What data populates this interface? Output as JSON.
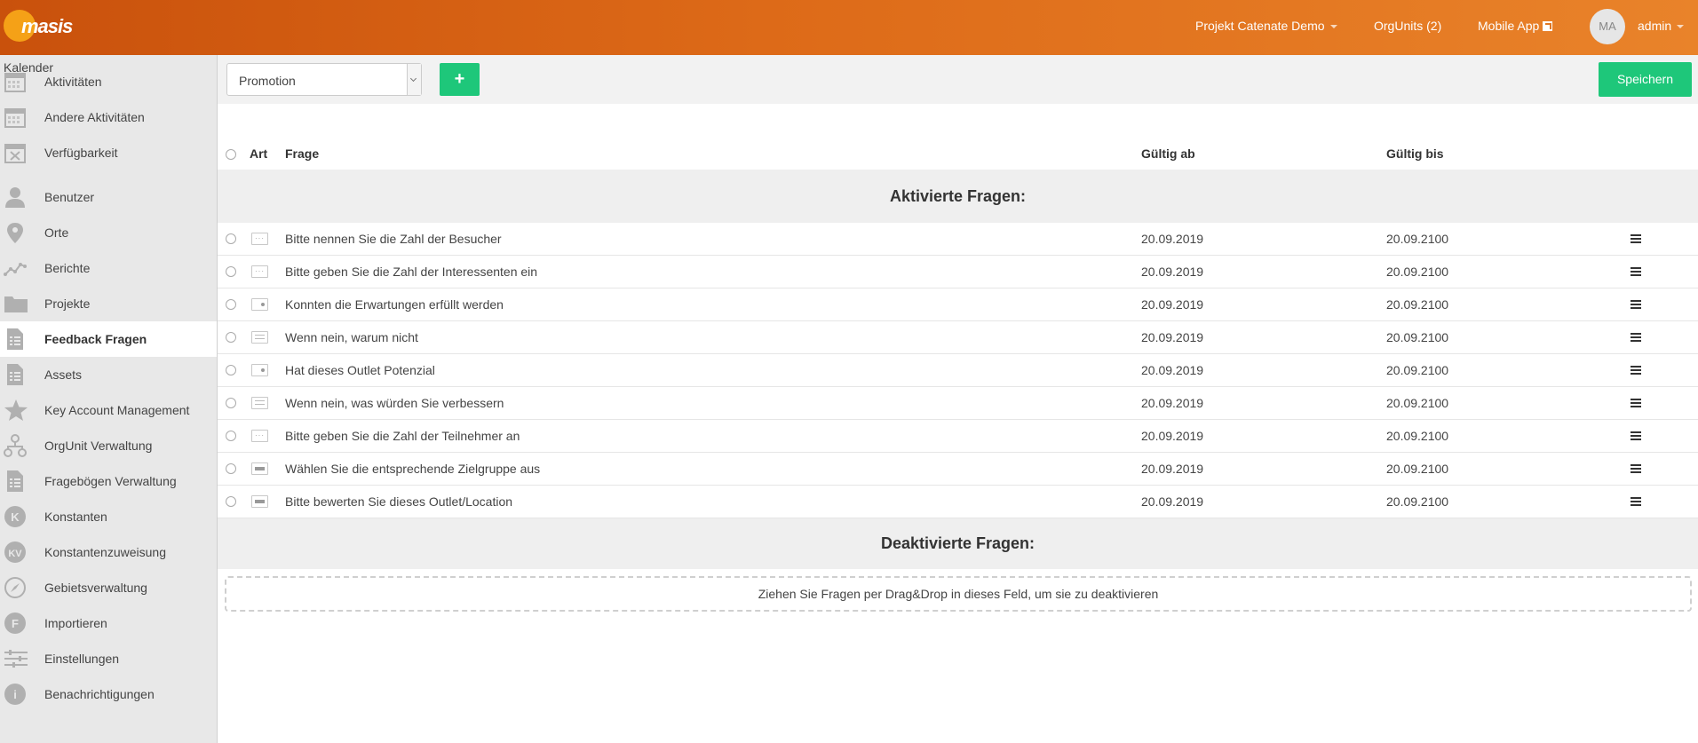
{
  "header": {
    "logo_text": "masis",
    "project": "Projekt Catenate Demo",
    "orgunits": "OrgUnits (2)",
    "mobile_app": "Mobile App",
    "avatar_initials": "MA",
    "user": "admin"
  },
  "sidebar": {
    "heading": "Kalender",
    "items": [
      {
        "label": "Aktivitäten",
        "icon": "calendar-icon"
      },
      {
        "label": "Andere Aktivitäten",
        "icon": "calendar-icon"
      },
      {
        "label": "Verfügbarkeit",
        "icon": "calendar-x-icon"
      },
      {
        "label": "Benutzer",
        "icon": "user-icon"
      },
      {
        "label": "Orte",
        "icon": "map-pin-icon"
      },
      {
        "label": "Berichte",
        "icon": "line-chart-icon"
      },
      {
        "label": "Projekte",
        "icon": "folder-icon"
      },
      {
        "label": "Feedback Fragen",
        "icon": "document-list-icon"
      },
      {
        "label": "Assets",
        "icon": "document-list-icon"
      },
      {
        "label": "Key Account Management",
        "icon": "star-icon"
      },
      {
        "label": "OrgUnit Verwaltung",
        "icon": "org-tree-icon"
      },
      {
        "label": "Fragebögen Verwaltung",
        "icon": "document-list-icon"
      },
      {
        "label": "Konstanten",
        "icon": "k-circle-icon",
        "glyph": "K"
      },
      {
        "label": "Konstantenzuweisung",
        "icon": "kv-circle-icon",
        "glyph": "KV"
      },
      {
        "label": "Gebietsverwaltung",
        "icon": "compass-icon"
      },
      {
        "label": "Importieren",
        "icon": "f-circle-icon",
        "glyph": "F"
      },
      {
        "label": "Einstellungen",
        "icon": "sliders-icon"
      },
      {
        "label": "Benachrichtigungen",
        "icon": "info-circle-icon",
        "glyph": "i"
      }
    ],
    "active_index": 7
  },
  "toolbar": {
    "select_value": "Promotion",
    "add_label": "+",
    "save_label": "Speichern"
  },
  "table": {
    "columns": {
      "art": "Art",
      "frage": "Frage",
      "gueltig_ab": "Gültig ab",
      "gueltig_bis": "Gültig bis"
    },
    "active_section": "Aktivierte Fragen:",
    "inactive_section": "Deaktivierte Fragen:",
    "rows": [
      {
        "type": "number",
        "question": "Bitte nennen Sie die Zahl der Besucher",
        "from": "20.09.2019",
        "to": "20.09.2100"
      },
      {
        "type": "number",
        "question": "Bitte geben Sie die Zahl der Interessenten ein",
        "from": "20.09.2019",
        "to": "20.09.2100"
      },
      {
        "type": "toggle",
        "question": "Konnten die Erwartungen erfüllt werden",
        "from": "20.09.2019",
        "to": "20.09.2100"
      },
      {
        "type": "text",
        "question": "Wenn nein, warum nicht",
        "from": "20.09.2019",
        "to": "20.09.2100"
      },
      {
        "type": "toggle",
        "question": "Hat dieses Outlet Potenzial",
        "from": "20.09.2019",
        "to": "20.09.2100"
      },
      {
        "type": "text",
        "question": "Wenn nein, was würden Sie verbessern",
        "from": "20.09.2019",
        "to": "20.09.2100"
      },
      {
        "type": "number",
        "question": "Bitte geben Sie die Zahl der Teilnehmer an",
        "from": "20.09.2019",
        "to": "20.09.2100"
      },
      {
        "type": "slider",
        "question": "Wählen Sie die entsprechende Zielgruppe aus",
        "from": "20.09.2019",
        "to": "20.09.2100"
      },
      {
        "type": "slider",
        "question": "Bitte bewerten Sie dieses Outlet/Location",
        "from": "20.09.2019",
        "to": "20.09.2100"
      }
    ],
    "dropzone_text": "Ziehen Sie Fragen per Drag&Drop in dieses Feld, um sie zu deaktivieren"
  },
  "colors": {
    "header_start": "#c9510c",
    "header_end": "#e9832a",
    "accent_green": "#1ec77a",
    "sidebar_bg": "#e8e8e8"
  }
}
